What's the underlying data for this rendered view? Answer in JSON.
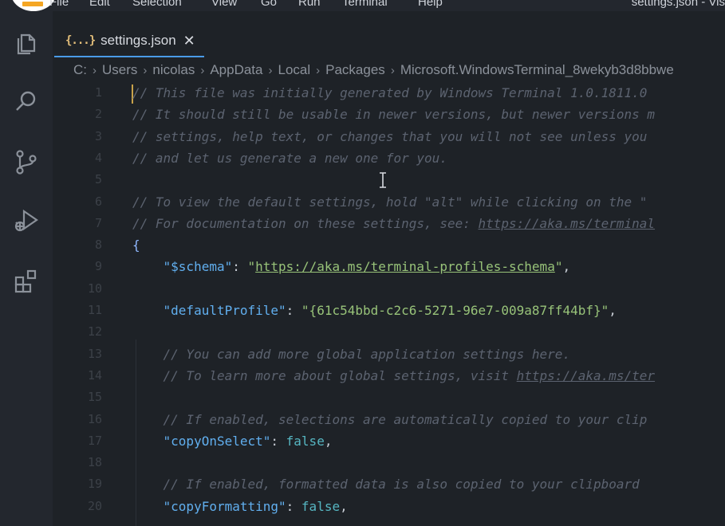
{
  "menu": {
    "items": [
      "File",
      "Edit",
      "Selection",
      "View",
      "Go",
      "Run",
      "Terminal",
      "Help"
    ],
    "window_title": "settings.json - Vis"
  },
  "tab": {
    "icon_text": "{...}",
    "label": "settings.json",
    "close": "✕"
  },
  "breadcrumb": [
    "C:",
    "Users",
    "nicolas",
    "AppData",
    "Local",
    "Packages",
    "Microsoft.WindowsTerminal_8wekyb3d8bbwe"
  ],
  "colors": {
    "comment": "#5c6370",
    "key": "#61afef",
    "string": "#98c379",
    "boolean": "#56b6c2",
    "tab_accent": "#4a9be8"
  },
  "lines": [
    {
      "n": "1",
      "indent": "",
      "tokens": [
        {
          "t": "c",
          "v": "// This file was initially generated by Windows Terminal 1.0.1811.0"
        }
      ]
    },
    {
      "n": "2",
      "indent": "",
      "tokens": [
        {
          "t": "c",
          "v": "// It should still be usable in newer versions, but newer versions m"
        }
      ]
    },
    {
      "n": "3",
      "indent": "",
      "tokens": [
        {
          "t": "c",
          "v": "// settings, help text, or changes that you will not see unless you"
        }
      ]
    },
    {
      "n": "4",
      "indent": "",
      "tokens": [
        {
          "t": "c",
          "v": "// and let us generate a new one for you."
        }
      ]
    },
    {
      "n": "5",
      "indent": "",
      "tokens": []
    },
    {
      "n": "6",
      "indent": "",
      "tokens": [
        {
          "t": "c",
          "v": "// To view the default settings, hold \"alt\" while clicking on the \""
        }
      ]
    },
    {
      "n": "7",
      "indent": "",
      "tokens": [
        {
          "t": "c",
          "v": "// For documentation on these settings, see: "
        },
        {
          "t": "cl",
          "v": "https://aka.ms/terminal"
        }
      ]
    },
    {
      "n": "8",
      "indent": "",
      "tokens": [
        {
          "t": "b",
          "v": "{"
        }
      ]
    },
    {
      "n": "9",
      "indent": "    ",
      "tokens": [
        {
          "t": "k",
          "v": "\"$schema\""
        },
        {
          "t": "p",
          "v": ": "
        },
        {
          "t": "s",
          "v": "\""
        },
        {
          "t": "sl",
          "v": "https://aka.ms/terminal-profiles-schema"
        },
        {
          "t": "s",
          "v": "\""
        },
        {
          "t": "p",
          "v": ","
        }
      ]
    },
    {
      "n": "10",
      "indent": "",
      "tokens": []
    },
    {
      "n": "11",
      "indent": "    ",
      "tokens": [
        {
          "t": "k",
          "v": "\"defaultProfile\""
        },
        {
          "t": "p",
          "v": ": "
        },
        {
          "t": "s",
          "v": "\"{61c54bbd-c2c6-5271-96e7-009a87ff44bf}\""
        },
        {
          "t": "p",
          "v": ","
        }
      ]
    },
    {
      "n": "12",
      "indent": "",
      "tokens": []
    },
    {
      "n": "13",
      "indent": "    ",
      "tokens": [
        {
          "t": "c",
          "v": "// You can add more global application settings here."
        }
      ]
    },
    {
      "n": "14",
      "indent": "    ",
      "tokens": [
        {
          "t": "c",
          "v": "// To learn more about global settings, visit "
        },
        {
          "t": "cl",
          "v": "https://aka.ms/ter"
        }
      ]
    },
    {
      "n": "15",
      "indent": "",
      "tokens": []
    },
    {
      "n": "16",
      "indent": "    ",
      "tokens": [
        {
          "t": "c",
          "v": "// If enabled, selections are automatically copied to your clip"
        }
      ]
    },
    {
      "n": "17",
      "indent": "    ",
      "tokens": [
        {
          "t": "k",
          "v": "\"copyOnSelect\""
        },
        {
          "t": "p",
          "v": ": "
        },
        {
          "t": "bo",
          "v": "false"
        },
        {
          "t": "p",
          "v": ","
        }
      ]
    },
    {
      "n": "18",
      "indent": "",
      "tokens": []
    },
    {
      "n": "19",
      "indent": "    ",
      "tokens": [
        {
          "t": "c",
          "v": "// If enabled, formatted data is also copied to your clipboard"
        }
      ]
    },
    {
      "n": "20",
      "indent": "    ",
      "tokens": [
        {
          "t": "k",
          "v": "\"copyFormatting\""
        },
        {
          "t": "p",
          "v": ": "
        },
        {
          "t": "bo",
          "v": "false"
        },
        {
          "t": "p",
          "v": ","
        }
      ]
    }
  ]
}
